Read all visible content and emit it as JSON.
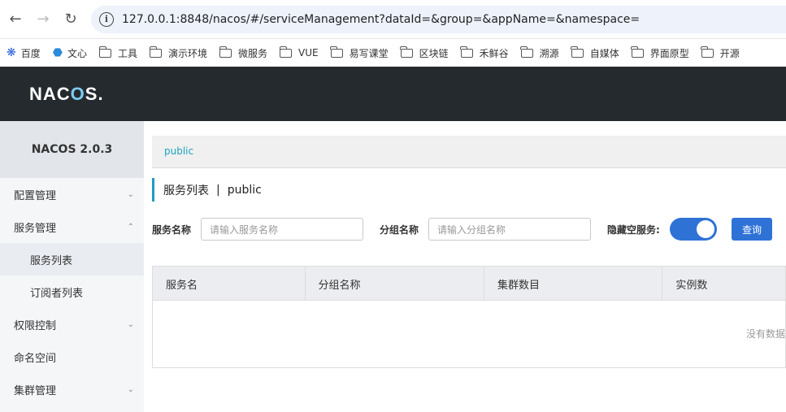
{
  "browser": {
    "url": "127.0.0.1:8848/nacos/#/serviceManagement?dataId=&group=&appName=&namespace=",
    "bookmarks": [
      "百度",
      "文心",
      "工具",
      "演示环境",
      "微服务",
      "VUE",
      "易写课堂",
      "区块链",
      "禾鲜谷",
      "溯源",
      "自媒体",
      "界面原型",
      "开源"
    ]
  },
  "header": {
    "logo_pre": "NAC",
    "logo_o": "O",
    "logo_post": "S."
  },
  "sidebar": {
    "title": "NACOS 2.0.3",
    "items": [
      {
        "label": "配置管理"
      },
      {
        "label": "服务管理"
      },
      {
        "label": "服务列表"
      },
      {
        "label": "订阅者列表"
      },
      {
        "label": "权限控制"
      },
      {
        "label": "命名空间"
      },
      {
        "label": "集群管理"
      }
    ]
  },
  "main": {
    "namespace": "public",
    "title": "服务列表",
    "title_sep": "|",
    "title_ns": "public",
    "filters": {
      "service_label": "服务名称",
      "service_placeholder": "请输入服务名称",
      "group_label": "分组名称",
      "group_placeholder": "请输入分组名称",
      "hide_empty_label": "隐藏空服务:",
      "query_label": "查询"
    },
    "table": {
      "columns": [
        "服务名",
        "分组名称",
        "集群数目",
        "实例数"
      ],
      "empty_text": "没有数据"
    }
  }
}
